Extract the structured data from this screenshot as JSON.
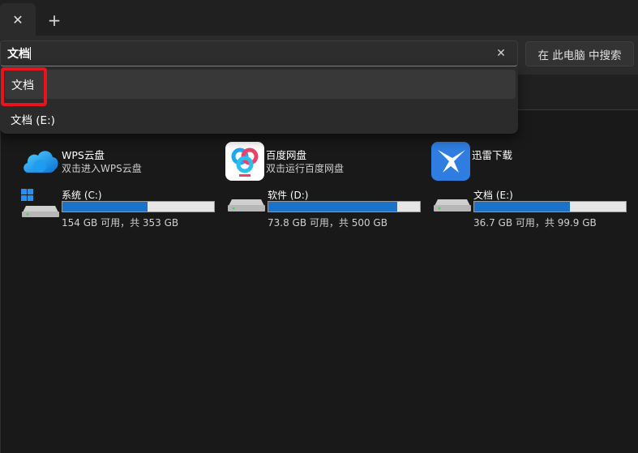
{
  "tabbar": {
    "close_glyph": "✕",
    "new_tab_glyph": "+"
  },
  "search": {
    "value": "文档",
    "placeholder": "",
    "clear_glyph": "✕"
  },
  "search_pc_button": {
    "label": "在 此电脑 中搜索"
  },
  "suggestions": [
    {
      "label": "文档",
      "highlighted": true
    },
    {
      "label": "文档 (E:)",
      "highlighted": false
    }
  ],
  "apps": [
    {
      "title": "WPS云盘",
      "subtitle": "双击进入WPS云盘",
      "icon": "wps-cloud-icon"
    },
    {
      "title": "百度网盘",
      "subtitle": "双击运行百度网盘",
      "icon": "baidu-netdisk-icon"
    },
    {
      "title": "迅雷下载",
      "subtitle": "",
      "icon": "xunlei-icon"
    }
  ],
  "drives": [
    {
      "name": "系统 (C:)",
      "space": "154 GB 可用，共 353 GB",
      "used_fraction": 0.564,
      "icon": "system-drive-icon"
    },
    {
      "name": "软件 (D:)",
      "space": "73.8 GB 可用，共 500 GB",
      "used_fraction": 0.852,
      "icon": "drive-icon"
    },
    {
      "name": "文档 (E:)",
      "space": "36.7 GB 可用，共 99.9 GB",
      "used_fraction": 0.632,
      "icon": "drive-icon"
    }
  ],
  "colors": {
    "accent": "#1a72c9",
    "highlight": "#e8131d",
    "background": "#191919"
  }
}
